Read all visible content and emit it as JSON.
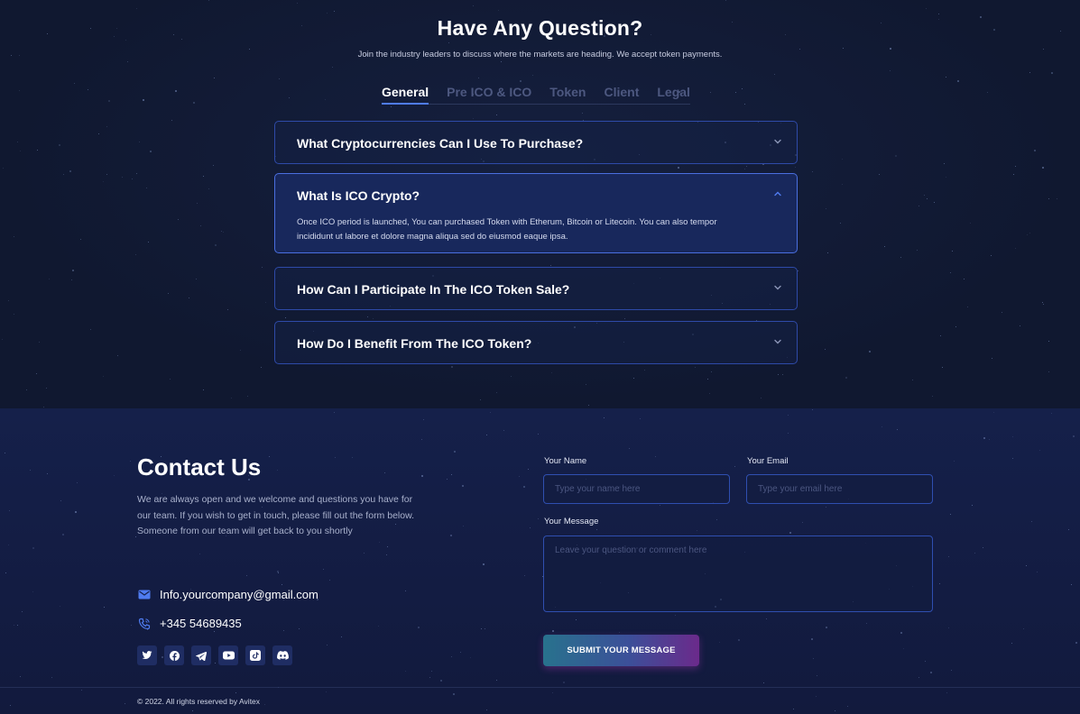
{
  "faq": {
    "title": "Have Any Question?",
    "subtitle": "Join the industry leaders to discuss where the markets are heading. We accept token payments.",
    "tabs": [
      "General",
      "Pre ICO & ICO",
      "Token",
      "Client",
      "Legal"
    ],
    "active_tab": "General",
    "items": [
      {
        "question": "What Cryptocurrencies Can I Use To Purchase?",
        "open": false
      },
      {
        "question": "What Is ICO Crypto?",
        "open": true,
        "answer": "Once ICO period is launched, You can purchased Token with Etherum, Bitcoin or Litecoin. You can also tempor incididunt ut labore et dolore magna aliqua sed do eiusmod eaque ipsa."
      },
      {
        "question": "How Can I Participate In The ICO Token Sale?",
        "open": false
      },
      {
        "question": "How Do I Benefit From The ICO Token?",
        "open": false
      }
    ]
  },
  "contact": {
    "title": "Contact Us",
    "description": "We are always open and we welcome and questions you have for our team. If you wish to get in touch, please fill out the form below. Someone from our team will get back to you shortly",
    "email": "Info.yourcompany@gmail.com",
    "phone": "+345 54689435",
    "socials": [
      "twitter-icon",
      "facebook-icon",
      "telegram-icon",
      "youtube-icon",
      "tiktok-icon",
      "discord-icon"
    ]
  },
  "form": {
    "name_label": "Your Name",
    "name_placeholder": "Type your name here",
    "email_label": "Your Email",
    "email_placeholder": "Type your email here",
    "message_label": "Your Message",
    "message_placeholder": "Leave your question or comment here",
    "submit_label": "SUBMIT YOUR MESSAGE"
  },
  "footer": {
    "copyright": "© 2022. All rights reserved by Avitex"
  },
  "colors": {
    "background": "#101830",
    "accent": "#4f7cf0",
    "border": "#2e4aa8",
    "button_gradient_start": "#28728d",
    "button_gradient_end": "#6b2a8b"
  }
}
